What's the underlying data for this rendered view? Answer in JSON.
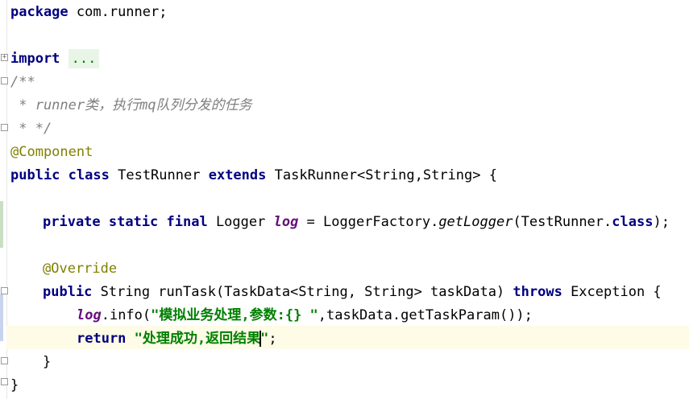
{
  "editor": {
    "package_kw": "package",
    "package_name": " com.runner;",
    "import_kw": "import",
    "import_folded": "...",
    "doc_open": "/**",
    "doc_line": " * runner类，执行mq队列分发的任务",
    "doc_close": " * */",
    "annotation_component": "@Component",
    "class_public": "public",
    "class_kw": "class",
    "class_name": "TestRunner",
    "extends_kw": "extends",
    "extends_type": "TaskRunner<String,String> {",
    "field_mods": "private static final",
    "field_type": " Logger ",
    "field_name": "log",
    "field_assign": " = LoggerFactory.",
    "field_method": "getLogger",
    "field_args": "(TestRunner.",
    "field_class_kw": "class",
    "field_end": ");",
    "annotation_override": "@Override",
    "method_public": "public",
    "method_sig": " String runTask(TaskData<String, String> taskData) ",
    "throws_kw": "throws",
    "method_exc": " Exception {",
    "log_ref": "log",
    "log_call": ".info(",
    "log_str": "\"模拟业务处理,参数:{} \"",
    "log_args": ",taskData.getTaskParam());",
    "return_kw": "return",
    "return_str_a": "\"处理成功,返回结果",
    "return_str_b": "\"",
    "return_end": ";",
    "close_method": "}",
    "close_class": "}"
  }
}
